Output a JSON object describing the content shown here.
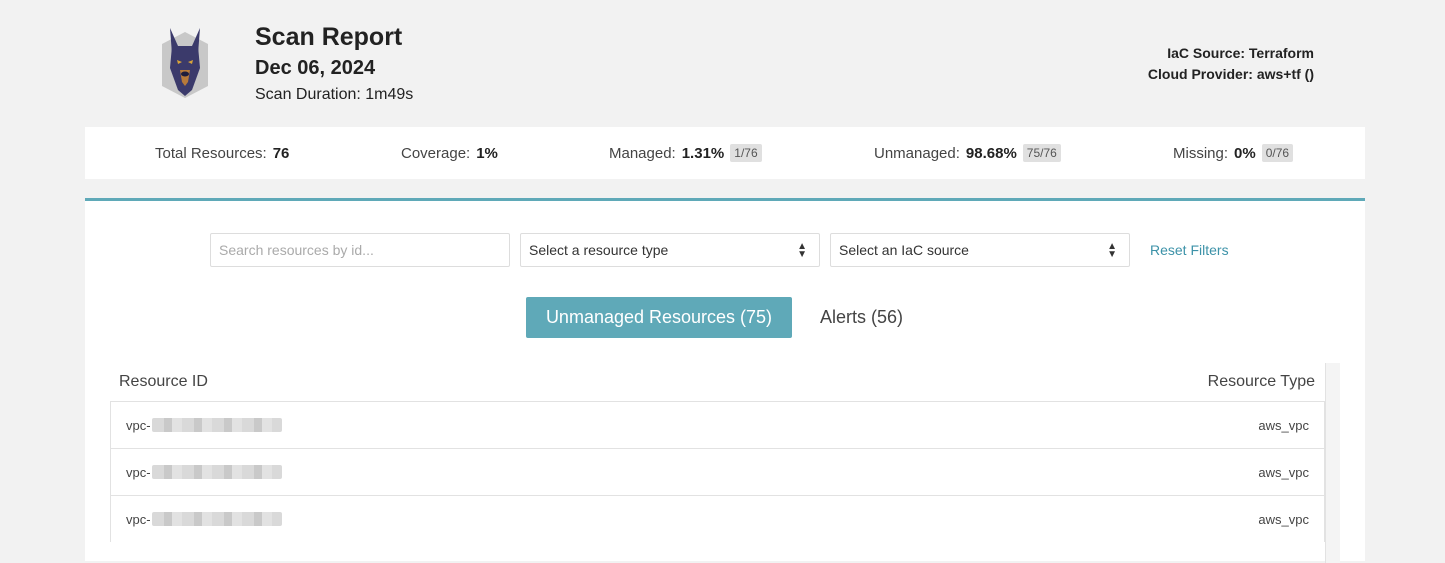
{
  "header": {
    "title": "Scan Report",
    "date": "Dec 06, 2024",
    "duration": "Scan Duration: 1m49s",
    "iac_source": "IaC Source: Terraform",
    "cloud_provider": "Cloud Provider: aws+tf ()"
  },
  "stats": {
    "total_label": "Total Resources:",
    "total_value": "76",
    "coverage_label": "Coverage:",
    "coverage_value": "1%",
    "managed_label": "Managed:",
    "managed_value": "1.31%",
    "managed_badge": "1/76",
    "unmanaged_label": "Unmanaged:",
    "unmanaged_value": "98.68%",
    "unmanaged_badge": "75/76",
    "missing_label": "Missing:",
    "missing_value": "0%",
    "missing_badge": "0/76"
  },
  "filters": {
    "search_placeholder": "Search resources by id...",
    "resource_type": "Select a resource type",
    "iac_source": "Select an IaC source",
    "reset": "Reset Filters"
  },
  "tabs": {
    "unmanaged": "Unmanaged Resources (75)",
    "alerts": "Alerts (56)"
  },
  "table": {
    "col_id": "Resource ID",
    "col_type": "Resource Type",
    "rows": [
      {
        "id_prefix": "vpc-",
        "type": "aws_vpc"
      },
      {
        "id_prefix": "vpc-",
        "type": "aws_vpc"
      },
      {
        "id_prefix": "vpc-",
        "type": "aws_vpc"
      }
    ]
  },
  "colors": {
    "accent": "#5fa9b8",
    "link": "#3c92a8",
    "background": "#f2f2f2"
  },
  "icons": {
    "logo": "doberman-logo-icon",
    "select_arrow": "sort-arrows-icon"
  }
}
